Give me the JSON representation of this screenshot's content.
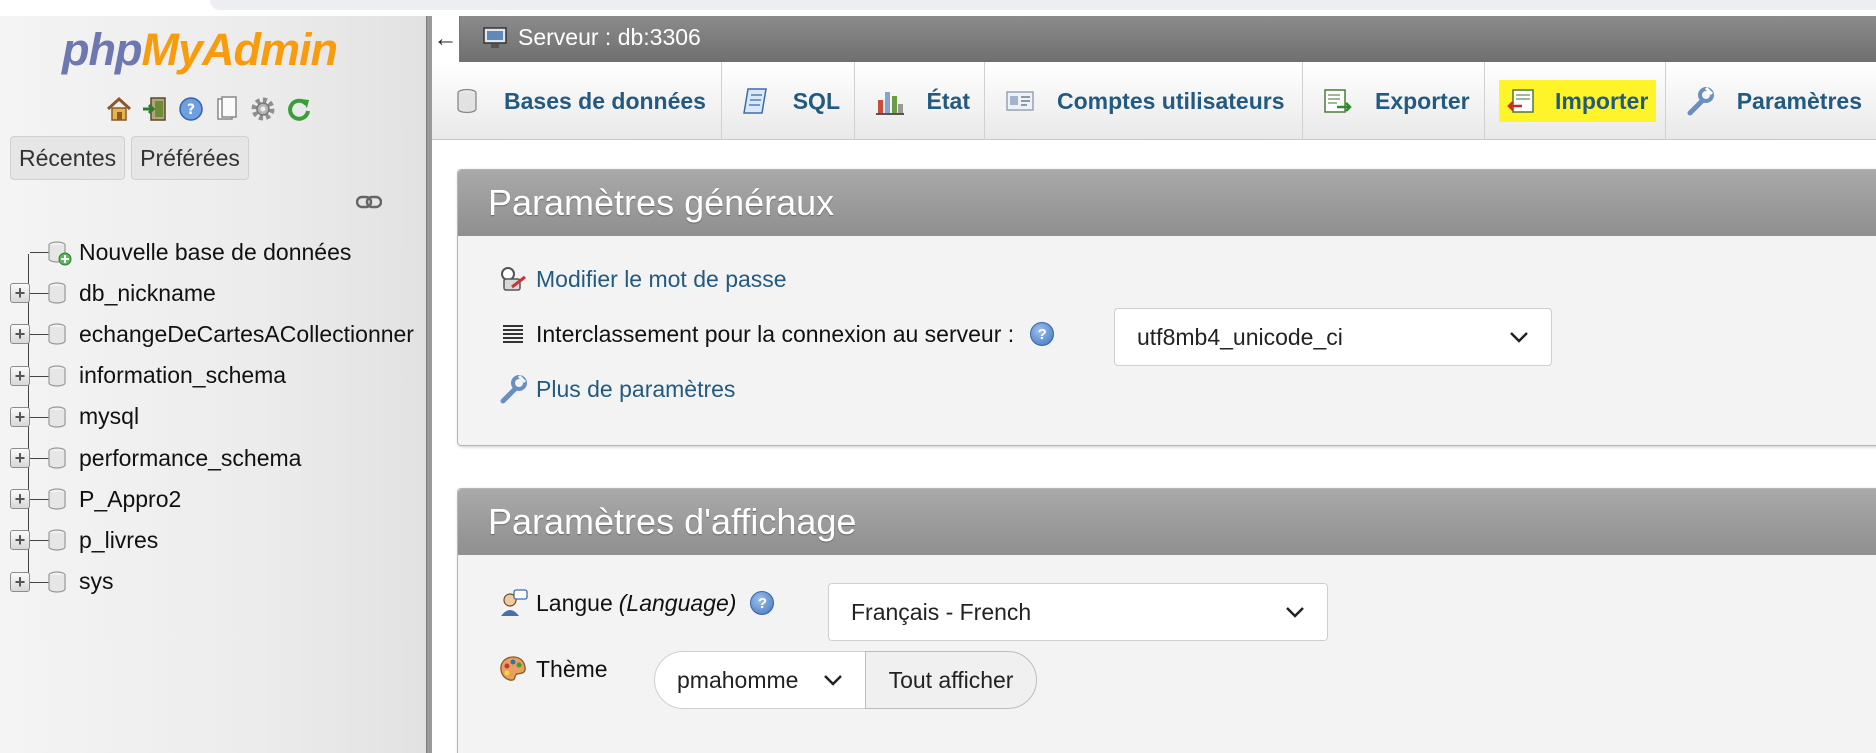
{
  "sidebar": {
    "logo": {
      "php": "php",
      "myadmin": "MyAdmin"
    },
    "icons": [
      "home-icon",
      "exit-icon",
      "help-icon",
      "docs-icon",
      "settings-gear-icon",
      "reload-icon"
    ],
    "tabs": [
      "Récentes",
      "Préférées"
    ],
    "databases": [
      {
        "label": "Nouvelle base de données",
        "kind": "new"
      },
      {
        "label": "db_nickname",
        "kind": "db"
      },
      {
        "label": "echangeDeCartesACollectionner",
        "kind": "db"
      },
      {
        "label": "information_schema",
        "kind": "db"
      },
      {
        "label": "mysql",
        "kind": "db"
      },
      {
        "label": "performance_schema",
        "kind": "db"
      },
      {
        "label": "P_Appro2",
        "kind": "db"
      },
      {
        "label": "p_livres",
        "kind": "db"
      },
      {
        "label": "sys",
        "kind": "db"
      }
    ]
  },
  "header": {
    "back": "←",
    "server": "Serveur : db:3306"
  },
  "nav": {
    "tabs": [
      {
        "label": "Bases de données",
        "icon": "database-icon"
      },
      {
        "label": "SQL",
        "icon": "sql-icon"
      },
      {
        "label": "État",
        "icon": "status-icon"
      },
      {
        "label": "Comptes utilisateurs",
        "icon": "users-icon"
      },
      {
        "label": "Exporter",
        "icon": "export-icon"
      },
      {
        "label": "Importer",
        "icon": "import-icon",
        "highlighted": true
      },
      {
        "label": "Paramètres",
        "icon": "wrench-icon"
      }
    ],
    "highlight_color": "#fff42a"
  },
  "general": {
    "title": "Paramètres généraux",
    "change_password": "Modifier le mot de passe",
    "collation_label": "Interclassement pour la connexion au serveur :",
    "collation_value": "utf8mb4_unicode_ci",
    "more_settings": "Plus de paramètres"
  },
  "display": {
    "title": "Paramètres d'affichage",
    "language_label": "Langue",
    "language_hint": "(Language)",
    "language_value": "Français - French",
    "theme_label": "Thème",
    "theme_value": "pmahomme",
    "show_all": "Tout afficher"
  },
  "colors": {
    "link": "#235a81",
    "logo_php": "#6c78af",
    "logo_myadmin": "#f89c0e",
    "panel_header": "#999999"
  }
}
